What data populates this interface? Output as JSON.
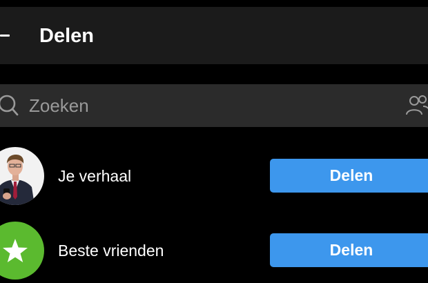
{
  "header": {
    "title": "Delen",
    "back_icon": "arrow-left-icon"
  },
  "search": {
    "placeholder": "Zoeken",
    "icon": "search-icon",
    "people_icon": "people-icon"
  },
  "share_targets": [
    {
      "label": "Je verhaal",
      "avatar": "profile-photo",
      "button_label": "Delen"
    },
    {
      "label": "Beste vrienden",
      "avatar": "star-icon",
      "button_label": "Delen"
    }
  ],
  "colors": {
    "background": "#000000",
    "header": "#1b1b1b",
    "search_bar": "#2b2b2b",
    "button": "#3d97ed",
    "close_friends_green": "#5bba2f",
    "placeholder": "#9a9a9a",
    "text": "#ffffff"
  }
}
